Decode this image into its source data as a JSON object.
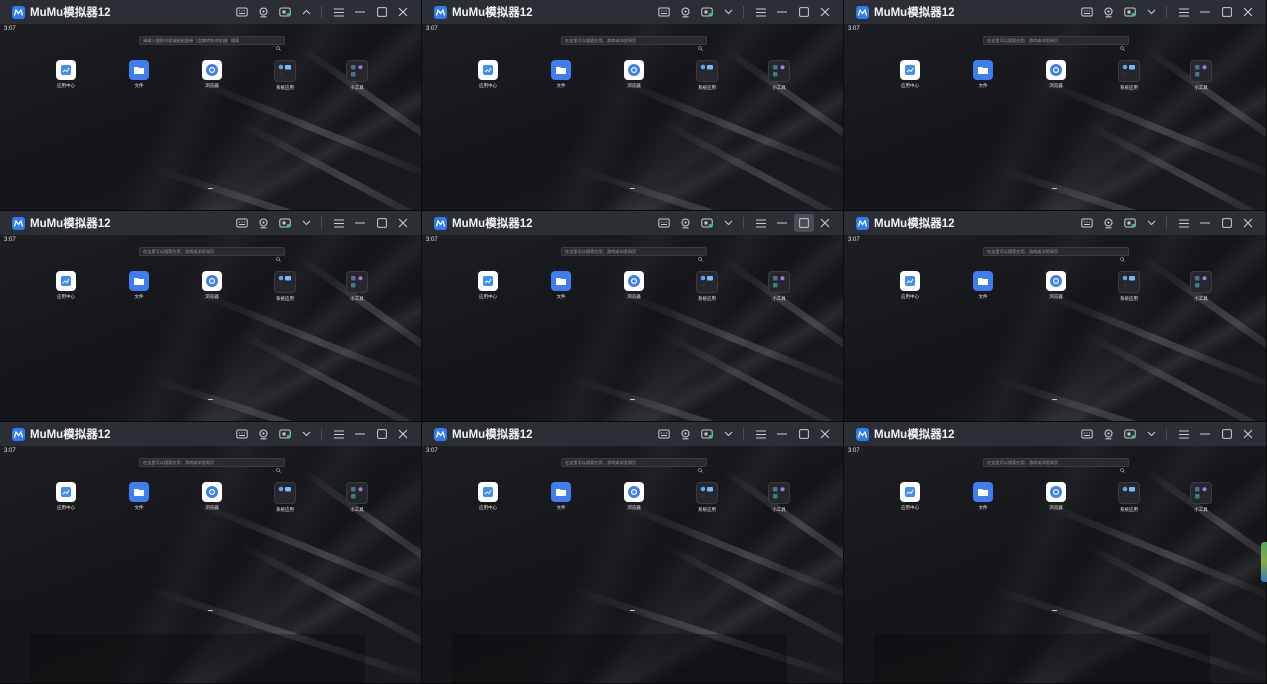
{
  "window_title": "MuMu模拟器12",
  "status_time": "3:07",
  "search_placeholder_first": "请输入搜索内容或粘贴链接（会跳转到浏览器）搜索",
  "search_placeholder": "在这里可以搜索应用、游戏或浏览网页",
  "apps": [
    {
      "label": "应用中心",
      "icon": "app-center-icon"
    },
    {
      "label": "文件",
      "icon": "files-icon"
    },
    {
      "label": "浏览器",
      "icon": "browser-icon"
    },
    {
      "label": "系统应用",
      "icon": "system-apps-folder-icon"
    },
    {
      "label": "小工具",
      "icon": "tools-folder-icon"
    }
  ],
  "toolbar_icons": [
    "keyboard-icon",
    "gamepad-icon",
    "screen-record-icon",
    "collapse-icon",
    "menu-icon",
    "minimize-icon",
    "maximize-icon",
    "close-icon"
  ],
  "windows": [
    {
      "collapse_direction": "up",
      "maximize_active": false
    },
    {
      "collapse_direction": "down",
      "maximize_active": false
    },
    {
      "collapse_direction": "down",
      "maximize_active": false
    },
    {
      "collapse_direction": "down",
      "maximize_active": false
    },
    {
      "collapse_direction": "down",
      "maximize_active": true
    },
    {
      "collapse_direction": "down",
      "maximize_active": false
    },
    {
      "collapse_direction": "down",
      "maximize_active": false
    },
    {
      "collapse_direction": "down",
      "maximize_active": false
    },
    {
      "collapse_direction": "down",
      "maximize_active": false
    }
  ],
  "colors": {
    "titlebar": "#2b2e35",
    "accent": "#2f7cf6",
    "desktop": "#16171b"
  }
}
